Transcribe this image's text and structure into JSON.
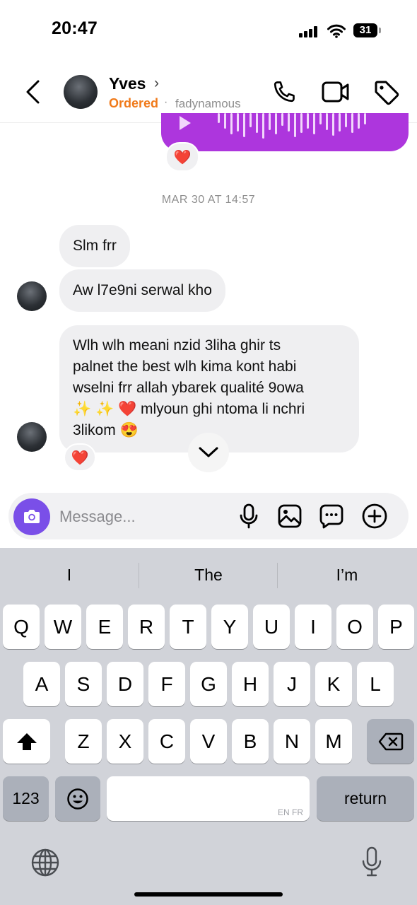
{
  "status_bar": {
    "time": "20:47",
    "battery": "31"
  },
  "header": {
    "contact_name": "Yves",
    "chevron": "›",
    "status_label": "Ordered",
    "separator": "·",
    "username": "fadynamous",
    "icons": [
      "back-chevron-icon",
      "phone-icon",
      "video-camera-icon",
      "tag-icon"
    ]
  },
  "conversation": {
    "voice_reaction": "❤️",
    "timestamp": "MAR 30 AT 14:57",
    "messages": [
      {
        "text": "Slm frr"
      },
      {
        "text": "Aw l7e9ni serwal kho"
      },
      {
        "lines": [
          "Wlh wlh meani nzid 3liha ghir ts",
          "palnet the best wlh kima kont habi",
          "wselni frr allah ybarek qualité 9owa",
          "✨ ✨ ❤️  mlyoun ghi ntoma li nchri",
          "3likom 😍"
        ],
        "reaction": "❤️"
      }
    ]
  },
  "composer": {
    "placeholder": "Message...",
    "icons": [
      "camera-icon",
      "microphone-icon",
      "gallery-icon",
      "sticker-icon",
      "add-icon"
    ]
  },
  "keyboard": {
    "suggestions": [
      "I",
      "The",
      "I’m"
    ],
    "row1": [
      "Q",
      "W",
      "E",
      "R",
      "T",
      "Y",
      "U",
      "I",
      "O",
      "P"
    ],
    "row2": [
      "A",
      "S",
      "D",
      "F",
      "G",
      "H",
      "J",
      "K",
      "L"
    ],
    "row3": [
      "Z",
      "X",
      "C",
      "V",
      "B",
      "N",
      "M"
    ],
    "numbers_key": "123",
    "return_key": "return",
    "language_hint": "EN FR",
    "icons": [
      "shift-icon",
      "backspace-icon",
      "emoji-icon",
      "globe-icon",
      "dictation-mic-icon"
    ]
  }
}
